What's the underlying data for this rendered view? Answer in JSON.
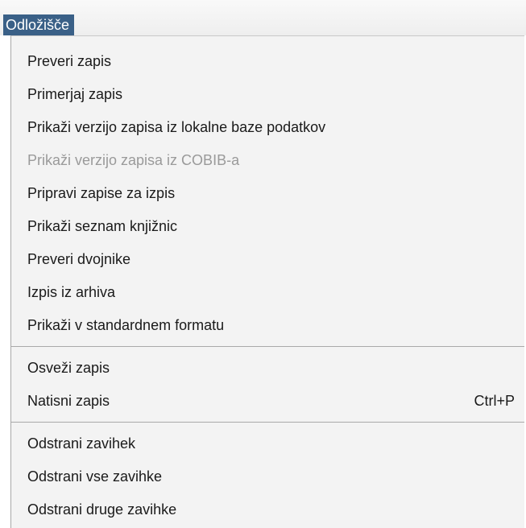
{
  "menubar": {
    "active_menu": "Odložišče"
  },
  "menu": {
    "group1": [
      {
        "label": "Preveri zapis",
        "enabled": true
      },
      {
        "label": "Primerjaj zapis",
        "enabled": true
      },
      {
        "label": "Prikaži verzijo zapisa iz lokalne baze podatkov",
        "enabled": true
      },
      {
        "label": "Prikaži verzijo zapisa iz COBIB-a",
        "enabled": false
      },
      {
        "label": "Pripravi zapise za izpis",
        "enabled": true
      },
      {
        "label": "Prikaži seznam knjižnic",
        "enabled": true
      },
      {
        "label": "Preveri dvojnike",
        "enabled": true
      },
      {
        "label": "Izpis iz arhiva",
        "enabled": true
      },
      {
        "label": "Prikaži v standardnem formatu",
        "enabled": true
      }
    ],
    "group2": [
      {
        "label": "Osveži zapis",
        "enabled": true
      },
      {
        "label": "Natisni zapis",
        "shortcut": "Ctrl+P",
        "enabled": true
      }
    ],
    "group3": [
      {
        "label": "Odstrani zavihek",
        "enabled": true
      },
      {
        "label": "Odstrani vse zavihke",
        "enabled": true
      },
      {
        "label": "Odstrani druge zavihke",
        "enabled": true
      }
    ]
  },
  "colors": {
    "menubar_selected": "#3a6087",
    "menu_background": "#f3f3f3",
    "disabled_text": "#9a9a9a"
  }
}
